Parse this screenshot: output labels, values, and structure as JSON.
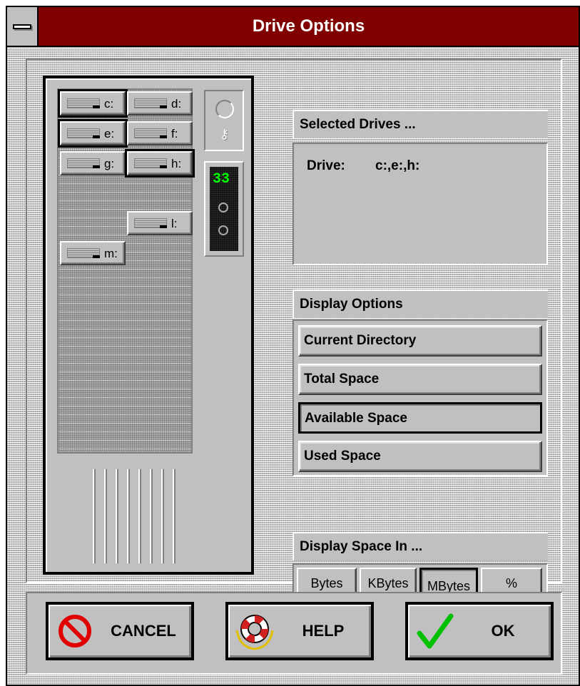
{
  "window": {
    "title": "Drive Options"
  },
  "drives": [
    {
      "label": "c:",
      "selected": true
    },
    {
      "label": "d:",
      "selected": false
    },
    {
      "label": "e:",
      "selected": true
    },
    {
      "label": "f:",
      "selected": false
    },
    {
      "label": "g:",
      "selected": false
    },
    {
      "label": "h:",
      "selected": true
    },
    {
      "label": "l:",
      "selected": false
    },
    {
      "label": "m:",
      "selected": false
    }
  ],
  "counter": {
    "value": "33"
  },
  "selected_drives": {
    "title": "Selected Drives ...",
    "label": "Drive:",
    "value": "c:,e:,h:"
  },
  "display_options": {
    "title": "Display Options",
    "items": [
      {
        "label": "Current Directory",
        "active": false
      },
      {
        "label": "Total Space",
        "active": false
      },
      {
        "label": "Available Space",
        "active": true
      },
      {
        "label": "Used Space",
        "active": false
      }
    ]
  },
  "display_space": {
    "title": "Display Space In ...",
    "units": [
      {
        "label": "Bytes",
        "active": false
      },
      {
        "label": "KBytes",
        "active": false
      },
      {
        "label": "MBytes",
        "active": true
      },
      {
        "label": "%",
        "active": false
      }
    ]
  },
  "actions": {
    "cancel": {
      "label": "CANCEL",
      "icon": "no-entry-icon"
    },
    "help": {
      "label": "HELP",
      "icon": "life-preserver-icon"
    },
    "ok": {
      "label": "OK",
      "icon": "checkmark-icon"
    }
  },
  "colors": {
    "titlebar": "#800000",
    "face": "#c0c0c0",
    "counter_digits": "#00ff00",
    "cancel_icon": "#e00000",
    "ok_icon": "#00c000"
  }
}
